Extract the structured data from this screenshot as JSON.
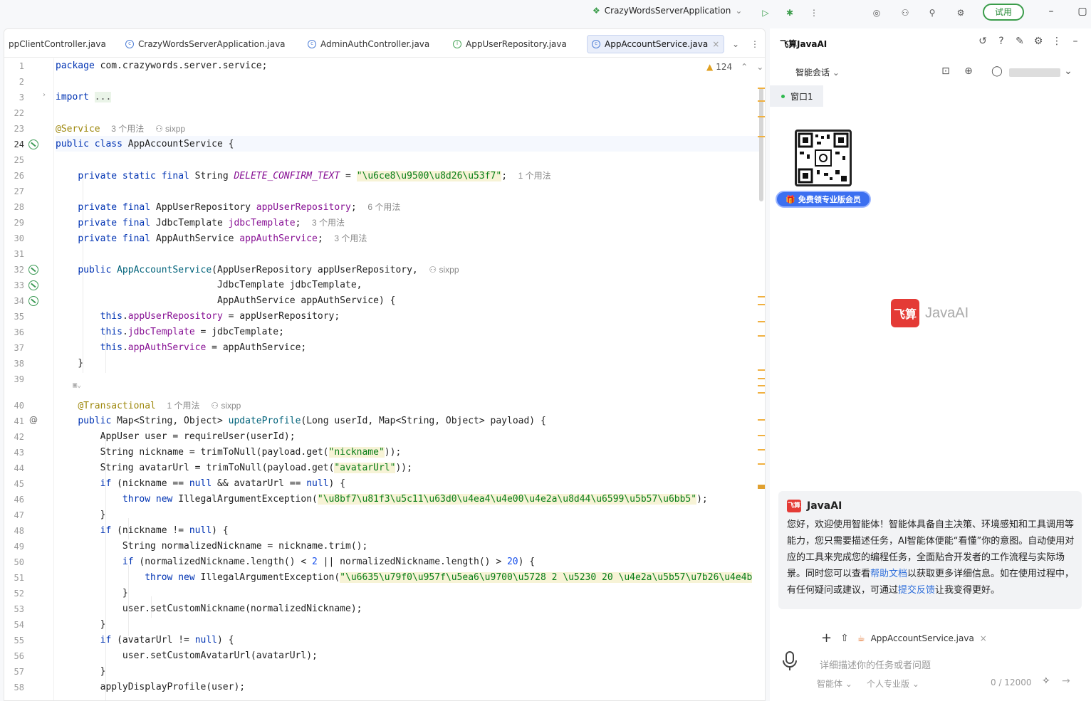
{
  "toolbar": {
    "run_config": "CrazyWordsServerApplication",
    "trial_label": "试用"
  },
  "tabs": [
    {
      "label": "ppClientController.java"
    },
    {
      "label": "CrazyWordsServerApplication.java"
    },
    {
      "label": "AdminAuthController.java"
    },
    {
      "label": "AppUserRepository.java"
    },
    {
      "label": "AppAccountService.java"
    }
  ],
  "editor": {
    "warning_count": "124",
    "line_numbers": [
      "1",
      "2",
      "3",
      "22",
      "23",
      "24",
      "25",
      "26",
      "27",
      "28",
      "29",
      "30",
      "31",
      "32",
      "33",
      "34",
      "35",
      "36",
      "37",
      "38",
      "39",
      "40",
      "41",
      "42",
      "43",
      "44",
      "45",
      "46",
      "47",
      "48",
      "49",
      "50",
      "51",
      "52",
      "53",
      "54",
      "55",
      "56",
      "57",
      "58"
    ],
    "hints": {
      "usages_3": "3 个用法",
      "author": "sixpp",
      "usages_1": "1 个用法",
      "usages_6": "6 个用法"
    }
  },
  "ai_panel": {
    "title": "飞算JavaAI",
    "session_label": "智能会话",
    "window_tab": "窗口1",
    "promo": "免费领专业版会员",
    "logo_text": "JavaAI",
    "logo_mark": "飞算",
    "message": {
      "sender": "JavaAI",
      "text_1": "您好，欢迎使用智能体！智能体具备自主决策、环境感知和工具调用等能力，您只需要描述任务，AI智能体便能“看懂”你的意图。自动使用对应的工具来完成您的编程任务，全面贴合开发者的工作流程与实际场景。同时您可以查看",
      "link_1": "帮助文档",
      "text_2": "以获取更多详细信息。如在使用过程中，有任何疑问或建议，可通过",
      "link_2": "提交反馈",
      "text_3": "让我变得更好。"
    },
    "composer": {
      "attached_file": "AppAccountService.java",
      "placeholder": "详细描述你的任务或者问题",
      "mode": "智能体",
      "plan": "个人专业版",
      "counter": "0 / 12000"
    }
  }
}
